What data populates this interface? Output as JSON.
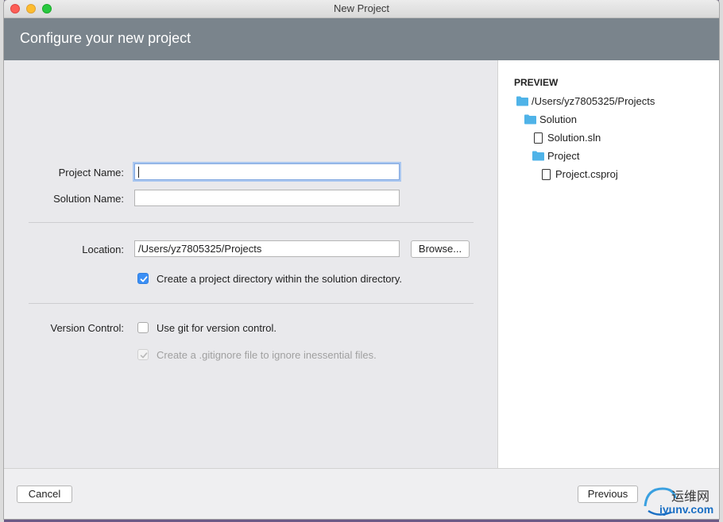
{
  "window": {
    "title": "New Project"
  },
  "header": {
    "title": "Configure your new project"
  },
  "form": {
    "project_name_label": "Project Name:",
    "project_name_value": "",
    "solution_name_label": "Solution Name:",
    "solution_name_value": "",
    "location_label": "Location:",
    "location_value": "/Users/yz7805325/Projects",
    "browse_label": "Browse...",
    "create_dir_label": "Create a project directory within the solution directory.",
    "create_dir_checked": true,
    "version_control_label": "Version Control:",
    "use_git_label": "Use git for version control.",
    "use_git_checked": false,
    "gitignore_label": "Create a .gitignore file to ignore inessential files.",
    "gitignore_checked": true,
    "gitignore_enabled": false
  },
  "preview": {
    "title": "PREVIEW",
    "tree": [
      {
        "label": "/Users/yz7805325/Projects",
        "kind": "folder-icon",
        "depth": 0
      },
      {
        "label": "Solution",
        "kind": "folder-icon",
        "depth": 1
      },
      {
        "label": "Solution.sln",
        "kind": "file-icon",
        "depth": 2
      },
      {
        "label": "Project",
        "kind": "folder-icon",
        "depth": 2
      },
      {
        "label": "Project.csproj",
        "kind": "file-icon",
        "depth": 3
      }
    ]
  },
  "footer": {
    "cancel_label": "Cancel",
    "previous_label": "Previous"
  },
  "watermark": {
    "text_cn": "运维网",
    "text_url": "iyunv.com"
  },
  "colors": {
    "header_bg": "#7a848c",
    "folder": "#4fb3e8",
    "checkbox_checked": "#3b8ff5",
    "focus_ring": "#aac7f0"
  }
}
